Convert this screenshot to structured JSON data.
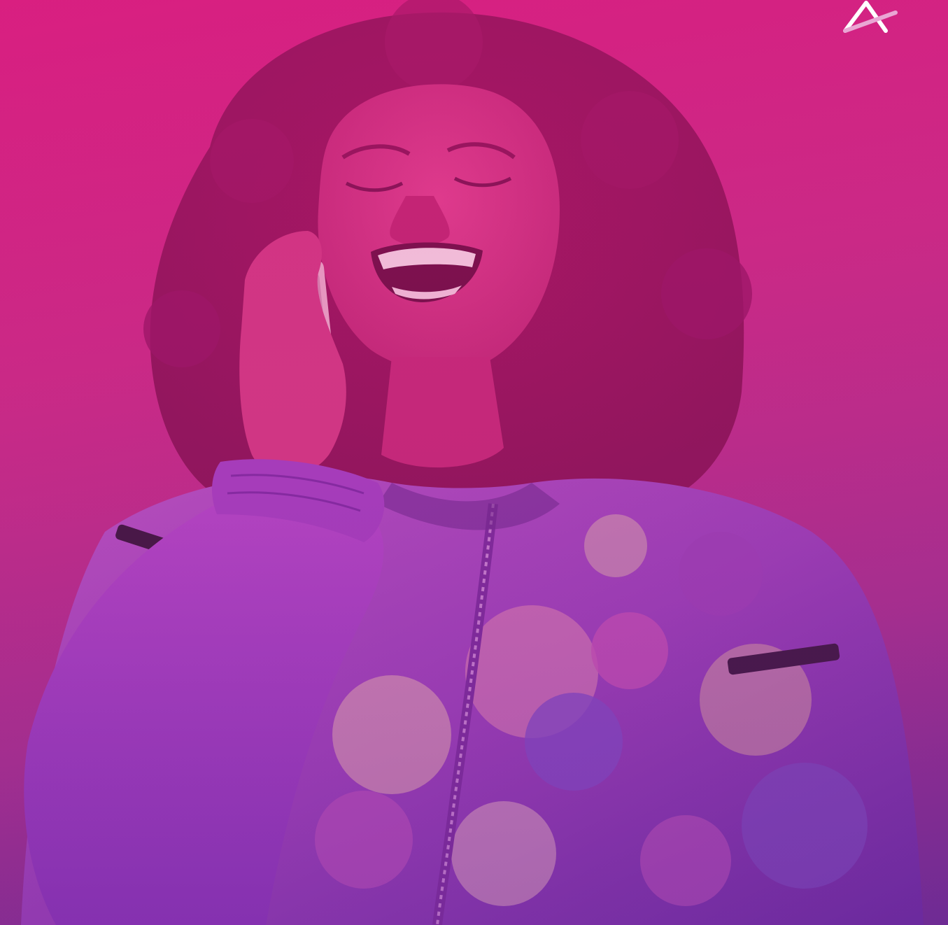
{
  "image": {
    "subject": "person-laughing-on-phone",
    "overlay_color": "#d81f80",
    "overlay_color_secondary": "#6e2c93"
  },
  "brand": {
    "icon": "logo-mark-icon",
    "stroke_color": "#ffffff",
    "accent_color": "#e9a6d4"
  }
}
